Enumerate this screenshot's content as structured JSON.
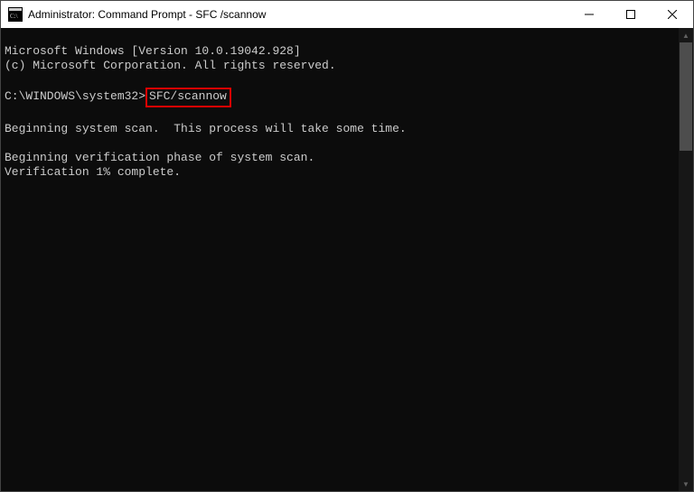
{
  "window": {
    "title": "Administrator: Command Prompt - SFC /scannow"
  },
  "terminal": {
    "banner_version": "Microsoft Windows [Version 10.0.19042.928]",
    "banner_copyright": "(c) Microsoft Corporation. All rights reserved.",
    "prompt_path": "C:\\WINDOWS\\system32>",
    "command": "SFC/scannow",
    "line_scanstart": "Beginning system scan.  This process will take some time.",
    "line_verifystart": "Beginning verification phase of system scan.",
    "line_progress": "Verification 1% complete."
  }
}
